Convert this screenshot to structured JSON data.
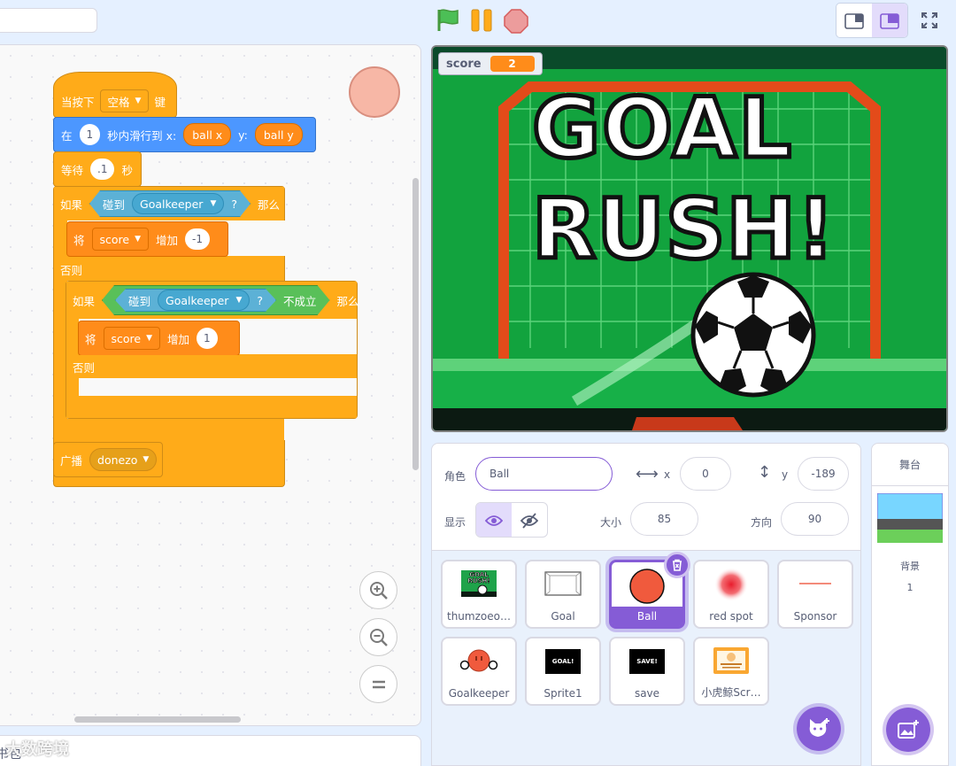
{
  "code": {
    "hat": {
      "label": "当按下",
      "key": "空格",
      "suffix": "键"
    },
    "glide": {
      "prefix": "在",
      "secs": "1",
      "mid": "秒内滑行到 x:",
      "x": "ball x",
      "ylab": "y:",
      "y": "ball y"
    },
    "wait": {
      "label": "等待",
      "secs": ".1",
      "suffix": "秒"
    },
    "if1": {
      "label": "如果",
      "touch": "碰到",
      "target": "Goalkeeper",
      "q": "?",
      "then": "那么"
    },
    "change1": {
      "label": "将",
      "var": "score",
      "op": "增加",
      "val": "-1"
    },
    "else1": "否则",
    "if2": {
      "label": "如果",
      "touch": "碰到",
      "target": "Goalkeeper",
      "q": "?",
      "not": "不成立",
      "then": "那么"
    },
    "change2": {
      "label": "将",
      "var": "score",
      "op": "增加",
      "val": "1"
    },
    "else2": "否则",
    "broadcast": {
      "label": "广播",
      "msg": "donezo"
    }
  },
  "stage": {
    "monitor_label": "score",
    "monitor_value": "2",
    "title_line1": "GOAL",
    "title_line2": "RUSH!"
  },
  "sprite_info": {
    "sprite_label": "角色",
    "sprite_name": "Ball",
    "x_label": "x",
    "x_value": "0",
    "y_label": "y",
    "y_value": "-189",
    "show_label": "显示",
    "size_label": "大小",
    "size_value": "85",
    "direction_label": "方向",
    "direction_value": "90"
  },
  "sprites": [
    {
      "name": "thumzoeo…"
    },
    {
      "name": "Goal"
    },
    {
      "name": "Ball"
    },
    {
      "name": "red spot"
    },
    {
      "name": "Sponsor"
    },
    {
      "name": "Goalkeeper"
    },
    {
      "name": "Sprite1"
    },
    {
      "name": "save"
    },
    {
      "name": "小虎鲸Scr…"
    }
  ],
  "sprite_thumb_text": {
    "sprite1": "GOAL!",
    "save": "SAVE!",
    "thumz": "GOAL RUSH!"
  },
  "stage_panel": {
    "title": "舞台",
    "backdrops_label": "背景",
    "backdrops_count": "1"
  },
  "backpack": {
    "label": "书包"
  },
  "watermark": "大数跨境",
  "colors": {
    "motion": "#4c97ff",
    "events": "#ffab19",
    "variables": "#ff8c1a",
    "sensing": "#5cb1d6",
    "operators": "#59c059",
    "accent": "#855cd6"
  }
}
